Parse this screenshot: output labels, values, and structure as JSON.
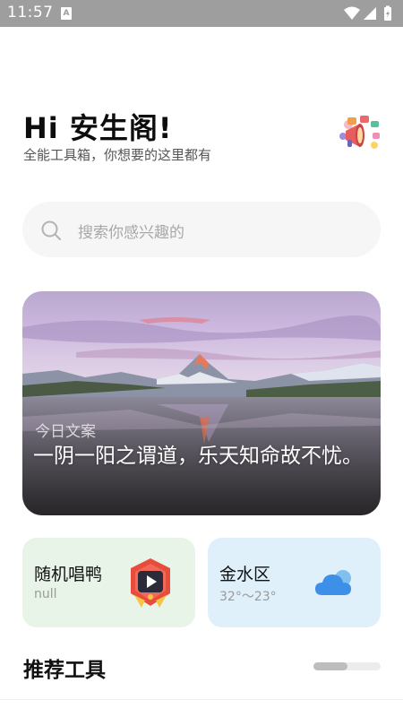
{
  "status_bar": {
    "time": "11:57",
    "notification_icon": "a-icon",
    "icons": [
      "wifi-icon",
      "signal-icon",
      "battery-charging-icon"
    ]
  },
  "header": {
    "title": "Hi 安生阁!",
    "subtitle": "全能工具箱，你想要的这里都有",
    "icon": "megaphone-icon"
  },
  "search": {
    "placeholder": "搜索你感兴趣的",
    "icon": "search-icon"
  },
  "quote_card": {
    "label": "今日文案",
    "text": "一阴一阳之谓道，乐天知命故不忧。"
  },
  "widgets": {
    "song": {
      "title": "随机唱鸭",
      "subtitle": "null",
      "icon": "play-badge-icon"
    },
    "weather": {
      "location": "金水区",
      "temperature": "32°～23°",
      "icon": "cloud-icon"
    }
  },
  "recommend": {
    "title": "推荐工具",
    "scroll_fraction": 0.5
  },
  "colors": {
    "song_card_bg": "#e7f4e7",
    "weather_card_bg": "#dff0fb",
    "status_bar_bg": "#9e9e9e",
    "cloud_blue": "#3d8fe8"
  }
}
